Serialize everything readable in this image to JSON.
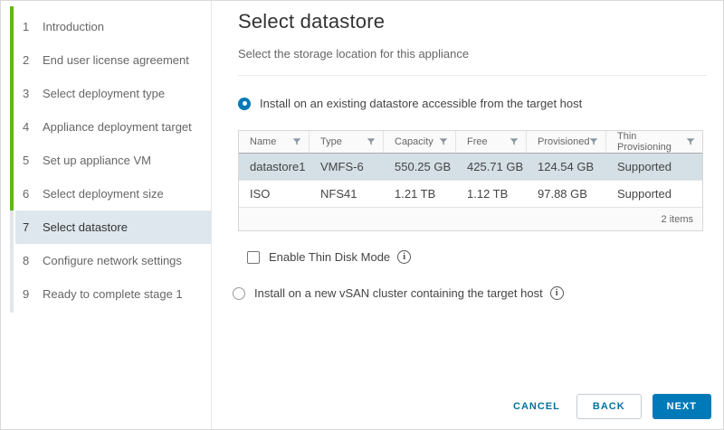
{
  "wizard": {
    "steps": [
      {
        "number": "1",
        "label": "Introduction"
      },
      {
        "number": "2",
        "label": "End user license agreement"
      },
      {
        "number": "3",
        "label": "Select deployment type"
      },
      {
        "number": "4",
        "label": "Appliance deployment target"
      },
      {
        "number": "5",
        "label": "Set up appliance VM"
      },
      {
        "number": "6",
        "label": "Select deployment size"
      },
      {
        "number": "7",
        "label": "Select datastore"
      },
      {
        "number": "8",
        "label": "Configure network settings"
      },
      {
        "number": "9",
        "label": "Ready to complete stage 1"
      }
    ],
    "current_step": "7"
  },
  "header": {
    "title": "Select datastore",
    "subtitle": "Select the storage location for this appliance"
  },
  "options": {
    "existing": {
      "label": "Install on an existing datastore accessible from the target host",
      "selected": true
    },
    "thin_disk": {
      "label": "Enable Thin Disk Mode",
      "checked": false
    },
    "vsan": {
      "label": "Install on a new vSAN cluster containing the target host",
      "selected": false
    }
  },
  "table": {
    "columns": [
      "Name",
      "Type",
      "Capacity",
      "Free",
      "Provisioned",
      "Thin Provisioning"
    ],
    "rows": [
      {
        "name": "datastore1",
        "type": "VMFS-6",
        "capacity": "550.25 GB",
        "free": "425.71 GB",
        "provisioned": "124.54 GB",
        "thin_provisioning": "Supported",
        "selected": true
      },
      {
        "name": "ISO",
        "type": "NFS41",
        "capacity": "1.21 TB",
        "free": "1.12 TB",
        "provisioned": "97.88 GB",
        "thin_provisioning": "Supported",
        "selected": false
      }
    ],
    "items_count": "2 items"
  },
  "buttons": {
    "cancel": "CANCEL",
    "back": "BACK",
    "next": "NEXT"
  },
  "icons": {
    "filter": "funnel-icon",
    "info": "info-icon"
  },
  "colors": {
    "progress_green": "#61b715",
    "primary_blue": "#0079b8",
    "link_blue": "#0072a3",
    "selected_row_bg": "#d5dfe6",
    "sidebar_active_bg": "#dee7ed"
  }
}
